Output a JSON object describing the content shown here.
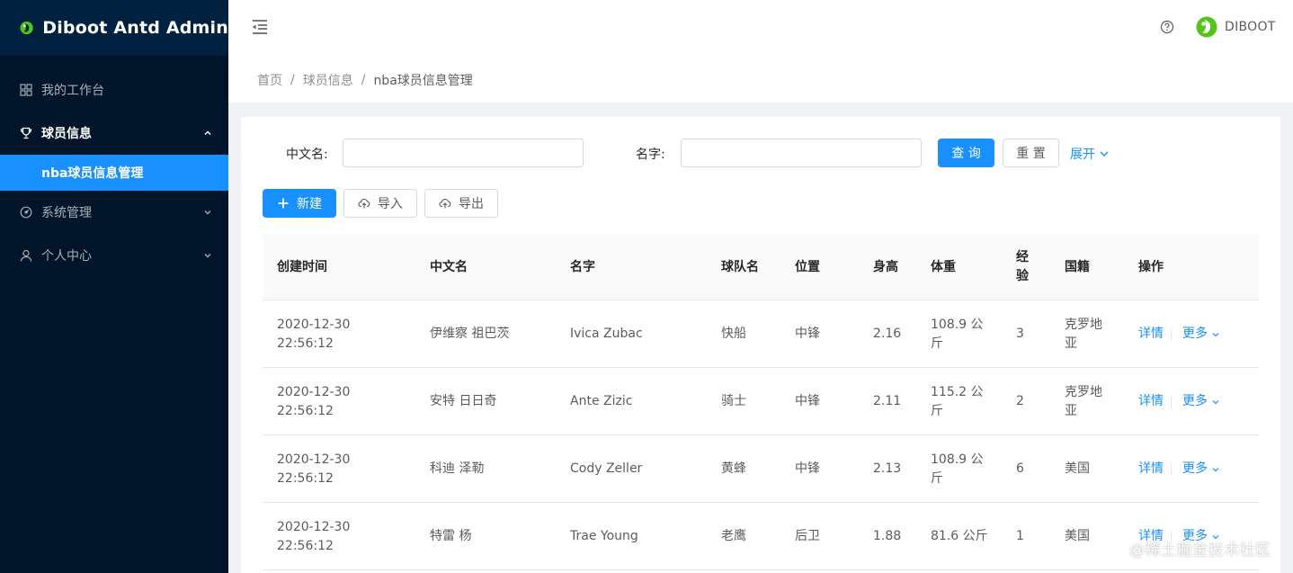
{
  "app": {
    "title": "Diboot Antd Admin"
  },
  "sidebar": {
    "items": [
      {
        "label": "我的工作台",
        "icon": "dashboard-icon"
      },
      {
        "label": "球员信息",
        "icon": "trophy-icon",
        "open": true,
        "children": [
          {
            "label": "nba球员信息管理",
            "active": true
          }
        ]
      },
      {
        "label": "系统管理",
        "icon": "settings-icon"
      },
      {
        "label": "个人中心",
        "icon": "user-icon"
      }
    ]
  },
  "header": {
    "user_name": "DIBOOT"
  },
  "breadcrumb": [
    "首页",
    "球员信息",
    "nba球员信息管理"
  ],
  "search": {
    "chinese_name_label": "中文名:",
    "chinese_name_value": "",
    "name_label": "名字:",
    "name_value": "",
    "query_label": "查 询",
    "reset_label": "重 置",
    "expand_label": "展开"
  },
  "toolbar": {
    "new_label": "新建",
    "import_label": "导入",
    "export_label": "导出"
  },
  "table": {
    "columns": [
      "创建时间",
      "中文名",
      "名字",
      "球队名",
      "位置",
      "身高",
      "体重",
      "经验",
      "国籍",
      "操作"
    ],
    "rows": [
      {
        "time": "2020-12-30 22:56:12",
        "cname": "伊维察 祖巴茨",
        "name": "Ivica Zubac",
        "team": "快船",
        "pos": "中锋",
        "height": "2.16",
        "weight": "108.9 公斤",
        "exp": "3",
        "nation": "克罗地亚"
      },
      {
        "time": "2020-12-30 22:56:12",
        "cname": "安特 日日奇",
        "name": "Ante Zizic",
        "team": "骑士",
        "pos": "中锋",
        "height": "2.11",
        "weight": "115.2 公斤",
        "exp": "2",
        "nation": "克罗地亚"
      },
      {
        "time": "2020-12-30 22:56:12",
        "cname": "科迪 泽勒",
        "name": "Cody Zeller",
        "team": "黄蜂",
        "pos": "中锋",
        "height": "2.13",
        "weight": "108.9 公斤",
        "exp": "6",
        "nation": "美国"
      },
      {
        "time": "2020-12-30 22:56:12",
        "cname": "特雷 杨",
        "name": "Trae Young",
        "team": "老鹰",
        "pos": "后卫",
        "height": "1.88",
        "weight": "81.6 公斤",
        "exp": "1",
        "nation": "美国"
      }
    ],
    "detail_label": "详情",
    "more_label": "更多"
  },
  "watermark": "@稀土掘金技术社区",
  "colors": {
    "primary": "#1890ff",
    "sider": "#001529",
    "logo_bg": "#002140",
    "brand_green": "#52c41a"
  }
}
